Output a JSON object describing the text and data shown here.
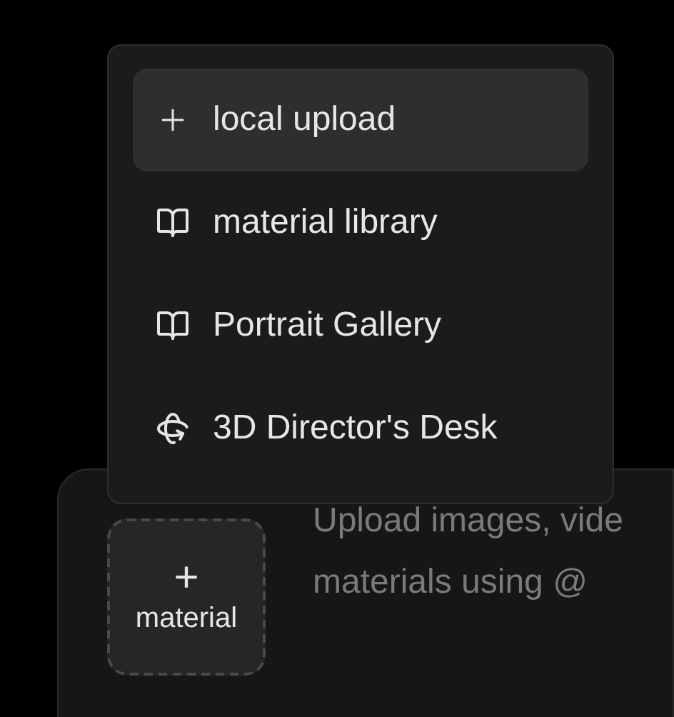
{
  "menu": {
    "items": [
      {
        "kind": "upload",
        "label": "local upload",
        "selected": true
      },
      {
        "kind": "library",
        "label": "material library",
        "selected": false
      },
      {
        "kind": "library",
        "label": "Portrait Gallery",
        "selected": false
      },
      {
        "kind": "director",
        "label": "3D Director's Desk",
        "selected": false
      }
    ]
  },
  "composer": {
    "add_button": {
      "icon": "+",
      "label": "material"
    },
    "placeholder_lines": [
      "Upload images, vide",
      "materials using @"
    ]
  }
}
